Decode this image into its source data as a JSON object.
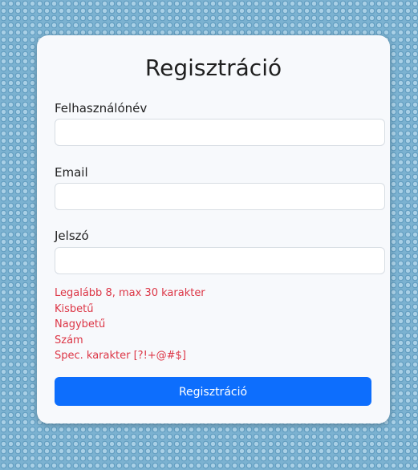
{
  "form": {
    "title": "Regisztráció",
    "username_label": "Felhasználónév",
    "username_value": "",
    "email_label": "Email",
    "email_value": "",
    "password_label": "Jelszó",
    "password_value": "",
    "requirements": [
      "Legalább 8, max 30 karakter",
      "Kisbetű",
      "Nagybetű",
      "Szám",
      "Spec. karakter [?!+@#$]"
    ],
    "submit_label": "Regisztráció"
  },
  "colors": {
    "primary": "#0d6efd",
    "error": "#dc3545",
    "card_bg": "#f7f9fc",
    "background": "#7cb2d1"
  }
}
